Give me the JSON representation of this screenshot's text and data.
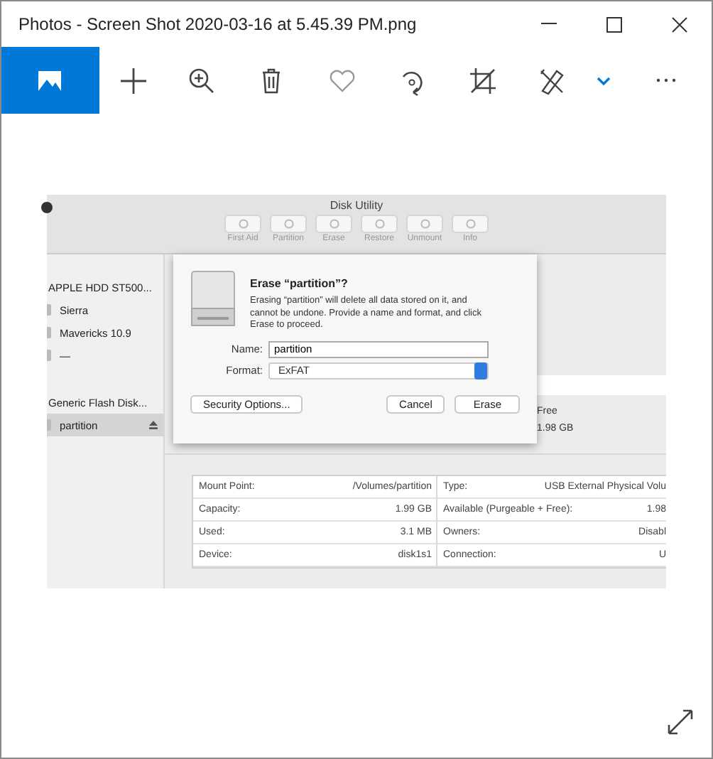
{
  "window": {
    "title": "Photos - Screen Shot 2020-03-16 at 5.45.39 PM.png"
  },
  "toolbar": {
    "buttons": [
      {
        "kind": "view",
        "selected": true
      },
      {
        "kind": "add",
        "selected": false
      },
      {
        "kind": "zoom",
        "selected": false
      },
      {
        "kind": "delete",
        "selected": false
      },
      {
        "kind": "favorite",
        "selected": false
      },
      {
        "kind": "rotate",
        "selected": false
      },
      {
        "kind": "crop",
        "selected": false
      },
      {
        "kind": "edit",
        "selected": false
      },
      {
        "kind": "dropdown",
        "selected": false
      },
      {
        "kind": "more",
        "selected": false
      }
    ]
  },
  "photo": {
    "app_title": "Disk Utility",
    "app_toolbar": [
      "First Aid",
      "Partition",
      "Erase",
      "Restore",
      "Unmount",
      "Info"
    ],
    "sidebar": {
      "items": [
        {
          "kind": "header",
          "label": "APPLE HDD ST500...",
          "selected": false,
          "ejectable": false
        },
        {
          "kind": "volume",
          "label": "Sierra",
          "selected": false,
          "ejectable": false
        },
        {
          "kind": "volume",
          "label": "Mavericks 10.9",
          "selected": false,
          "ejectable": false
        },
        {
          "kind": "volume",
          "label": "—",
          "selected": false,
          "ejectable": false
        },
        {
          "kind": "header",
          "label": "Generic Flash Disk...",
          "selected": false,
          "ejectable": false
        },
        {
          "kind": "volume",
          "label": "partition",
          "selected": true,
          "ejectable": true
        }
      ]
    },
    "free": {
      "label": "Free",
      "value": "1.98 GB"
    },
    "dialog": {
      "title": "Erase “partition”?",
      "message": "Erasing “partition” will delete all data stored on it, and cannot be undone. Provide a name and format, and click Erase to proceed.",
      "name_label": "Name:",
      "name_value": "partition",
      "format_label": "Format:",
      "format_value": "ExFAT",
      "buttons": [
        {
          "kind": "secondary",
          "label": "Security Options..."
        },
        {
          "kind": "normal",
          "label": "Cancel"
        },
        {
          "kind": "default",
          "label": "Erase"
        }
      ]
    },
    "info_table": {
      "rows": [
        {
          "label_1": "Mount Point:",
          "value_1": "/Volumes/partition",
          "label_2": "Type:",
          "value_2": "USB External Physical Volu"
        },
        {
          "label_1": "Capacity:",
          "value_1": "1.99 GB",
          "label_2": "Available (Purgeable + Free):",
          "value_2": "1.98 "
        },
        {
          "label_1": "Used:",
          "value_1": "3.1 MB",
          "label_2": "Owners:",
          "value_2": "Disabl"
        },
        {
          "label_1": "Device:",
          "value_1": "disk1s1",
          "label_2": "Connection:",
          "value_2": "U"
        }
      ]
    }
  }
}
